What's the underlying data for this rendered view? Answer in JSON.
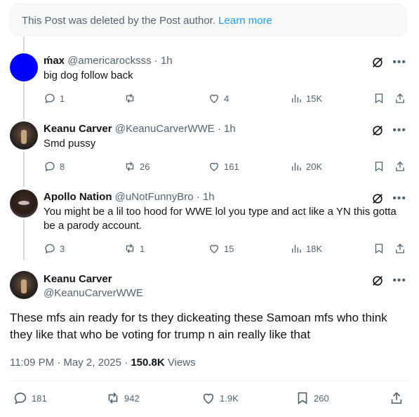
{
  "deleted_notice": {
    "text": "This Post was deleted by the Post author.",
    "link": "Learn more"
  },
  "replies": [
    {
      "name": "ḿax",
      "handle": "@americarocksss",
      "time": "· 1h",
      "text": "big dog follow back",
      "replies": "1",
      "reposts": "",
      "likes": "4",
      "views": "15K"
    },
    {
      "name": "Keanu Carver",
      "handle": "@KeanuCarverWWE",
      "time": "· 1h",
      "text": "Smd pussy",
      "replies": "8",
      "reposts": "26",
      "likes": "161",
      "views": "20K"
    },
    {
      "name": "Apollo Nation",
      "handle": "@uNotFunnyBro",
      "time": "· 1h",
      "text": "You might be a lil too hood for WWE lol you type and act like a YN this gotta be a parody account.",
      "replies": "3",
      "reposts": "1",
      "likes": "15",
      "views": "18K"
    }
  ],
  "main_post": {
    "name": "Keanu Carver",
    "handle": "@KeanuCarverWWE",
    "text": "These mfs ain ready for ts they dickeating these Samoan mfs who think they like that who be voting for trump n ain really like that",
    "time": "11:09 PM · May 2, 2025 ·",
    "views_count": "150.8K",
    "views_label": "Views",
    "replies": "181",
    "reposts": "942",
    "likes": "1.9K",
    "bookmarks": "260"
  },
  "icons": {
    "reply": "reply-icon",
    "repost": "repost-icon",
    "like": "heart-icon",
    "views": "views-icon",
    "bookmark": "bookmark-icon",
    "share": "share-icon",
    "grok": "grok-icon",
    "more": "more-icon"
  },
  "colors": {
    "link": "#1d9bf0",
    "muted": "#536471",
    "text": "#0f1419",
    "avatar_max": "#0000ff"
  }
}
